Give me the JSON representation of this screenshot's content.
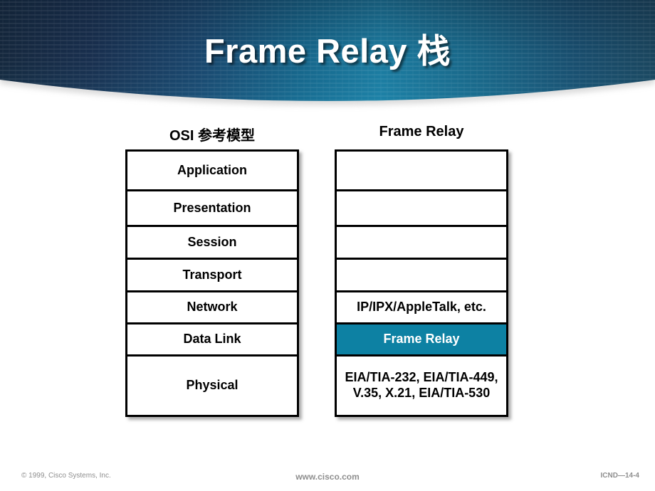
{
  "slide": {
    "title": "Frame Relay 栈",
    "background_color": "#ffffff"
  },
  "banner": {
    "gradient_dark_navy": "#16293f",
    "gradient_mid_navy": "#1b4a73",
    "gradient_teal": "#1d86ad",
    "gradient_right_navy": "#1c4a63",
    "shape": "ellipse-bottom-curve"
  },
  "diagram": {
    "left_column": {
      "header": "OSI 参考模型",
      "layers": [
        {
          "label": "Application",
          "highlight": false
        },
        {
          "label": "Presentation",
          "highlight": false
        },
        {
          "label": "Session",
          "highlight": false
        },
        {
          "label": "Transport",
          "highlight": false
        },
        {
          "label": "Network",
          "highlight": false
        },
        {
          "label": "Data Link",
          "highlight": false
        },
        {
          "label": "Physical",
          "highlight": false
        }
      ]
    },
    "right_column": {
      "header": "Frame Relay",
      "highlight_color": "#0d81a3",
      "layers": [
        {
          "label": "",
          "highlight": false
        },
        {
          "label": "",
          "highlight": false
        },
        {
          "label": "",
          "highlight": false
        },
        {
          "label": "",
          "highlight": false
        },
        {
          "label": "IP/IPX/AppleTalk, etc.",
          "highlight": false
        },
        {
          "label": "Frame Relay",
          "highlight": true
        },
        {
          "label": "EIA/TIA-232, EIA/TIA-449, V.35, X.21, EIA/TIA-530",
          "highlight": false
        }
      ]
    }
  },
  "footer": {
    "copyright": "© 1999, Cisco Systems, Inc.",
    "url": "www.cisco.com",
    "course_code": "ICND—14-4"
  }
}
